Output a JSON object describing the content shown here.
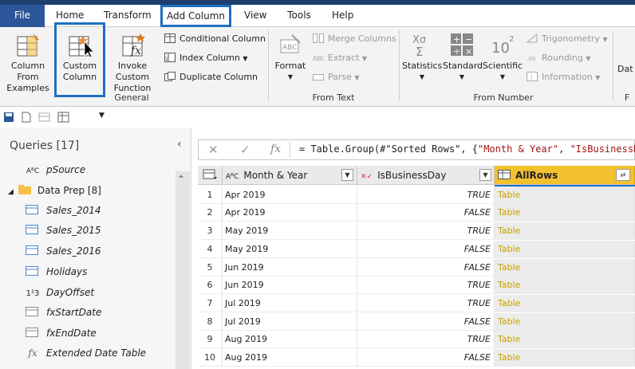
{
  "tabs": [
    "File",
    "Home",
    "Transform",
    "Add Column",
    "View",
    "Tools",
    "Help"
  ],
  "ribbon": {
    "general": {
      "group_label": "General",
      "column_from_examples": [
        "Column From",
        "Examples"
      ],
      "custom_column": [
        "Custom",
        "Column"
      ],
      "invoke_custom_function": [
        "Invoke Custom",
        "Function"
      ],
      "conditional_column": "Conditional Column",
      "index_column": "Index Column",
      "duplicate_column": "Duplicate Column"
    },
    "from_text": {
      "group_label": "From Text",
      "format": "Format",
      "merge_columns": "Merge Columns",
      "extract": "Extract",
      "parse": "Parse"
    },
    "from_number": {
      "group_label": "From Number",
      "statistics": "Statistics",
      "standard": "Standard",
      "scientific": "Scientific",
      "trigonometry": "Trigonometry",
      "rounding": "Rounding",
      "information": "Information"
    },
    "date": {
      "label": "Dat",
      "group_label": "F"
    }
  },
  "queries": {
    "title": "Queries [17]",
    "collapse": "‹",
    "items": [
      {
        "icon": "AᴮC",
        "label": "pSource",
        "indent": 1
      },
      {
        "icon": "▸",
        "label": "Data Prep [8]",
        "indent": 0,
        "folder": true
      },
      {
        "icon": "▦",
        "label": "Sales_2014",
        "indent": 1
      },
      {
        "icon": "▦",
        "label": "Sales_2015",
        "indent": 1
      },
      {
        "icon": "▦",
        "label": "Sales_2016",
        "indent": 1
      },
      {
        "icon": "▦",
        "label": "Holidays",
        "indent": 1
      },
      {
        "icon": "1²3",
        "label": "DayOffset",
        "indent": 1
      },
      {
        "icon": "▦",
        "label": "fxStartDate",
        "indent": 1
      },
      {
        "icon": "▦",
        "label": "fxEndDate",
        "indent": 1
      },
      {
        "icon": "fx",
        "label": "Extended Date Table",
        "indent": 1
      }
    ]
  },
  "formula": {
    "fx": "fx",
    "prefix": "= Table.Group(#\"Sorted Rows\", {",
    "part1": "\"Month & Year\"",
    "sep": ", ",
    "part2": "\"IsBusinessD"
  },
  "table": {
    "columns": [
      {
        "name": "Month & Year",
        "type_icon": "AᴮC"
      },
      {
        "name": "IsBusinessDay",
        "type_icon": "✕✓"
      },
      {
        "name": "AllRows",
        "type_icon": "▦"
      }
    ],
    "rows": [
      {
        "n": "1",
        "month": "Apr 2019",
        "biz": "TRUE",
        "all": "Table"
      },
      {
        "n": "2",
        "month": "Apr 2019",
        "biz": "FALSE",
        "all": "Table"
      },
      {
        "n": "3",
        "month": "May 2019",
        "biz": "TRUE",
        "all": "Table"
      },
      {
        "n": "4",
        "month": "May 2019",
        "biz": "FALSE",
        "all": "Table"
      },
      {
        "n": "5",
        "month": "Jun 2019",
        "biz": "FALSE",
        "all": "Table"
      },
      {
        "n": "6",
        "month": "Jun 2019",
        "biz": "TRUE",
        "all": "Table"
      },
      {
        "n": "7",
        "month": "Jul 2019",
        "biz": "TRUE",
        "all": "Table"
      },
      {
        "n": "8",
        "month": "Jul 2019",
        "biz": "FALSE",
        "all": "Table"
      },
      {
        "n": "9",
        "month": "Aug 2019",
        "biz": "TRUE",
        "all": "Table"
      },
      {
        "n": "10",
        "month": "Aug 2019",
        "biz": "FALSE",
        "all": "Table"
      }
    ]
  },
  "colors": {
    "accent": "#2b579a",
    "highlight": "#1f6fbf",
    "selected_column": "#f2c12e",
    "table_link": "#c8a000"
  }
}
